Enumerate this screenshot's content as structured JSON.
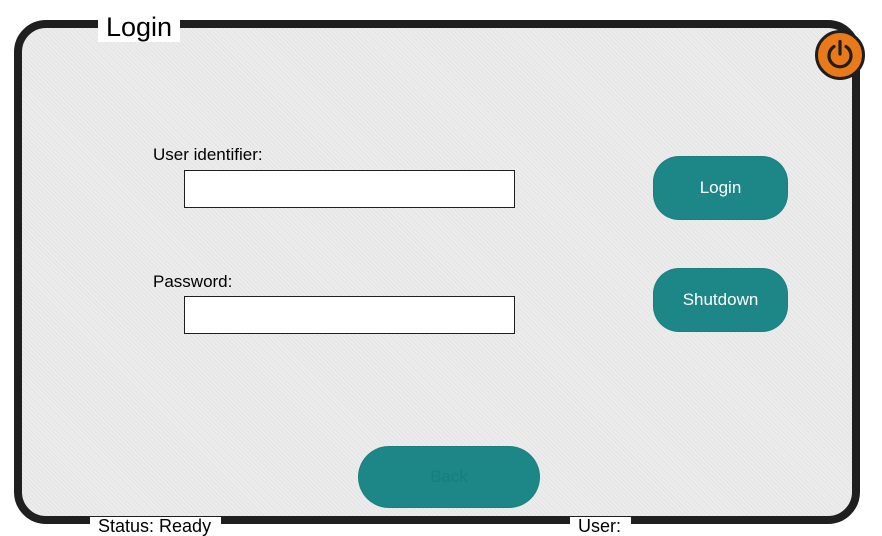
{
  "window": {
    "title": "Login"
  },
  "form": {
    "user_identifier_label": "User identifier:",
    "user_identifier_value": "",
    "password_label": "Password:",
    "password_value": ""
  },
  "actions": {
    "login_label": "Login",
    "shutdown_label": "Shutdown",
    "back_label": "Back",
    "back_enabled": false
  },
  "status_bar": {
    "status_text": "Status: Ready",
    "user_text": "User:"
  },
  "icons": {
    "power": "power-icon"
  },
  "colors": {
    "accent_teal": "#1d8686",
    "power_orange": "#ea7a19",
    "frame": "#1f1f1f",
    "panel_bg": "#ececec"
  }
}
